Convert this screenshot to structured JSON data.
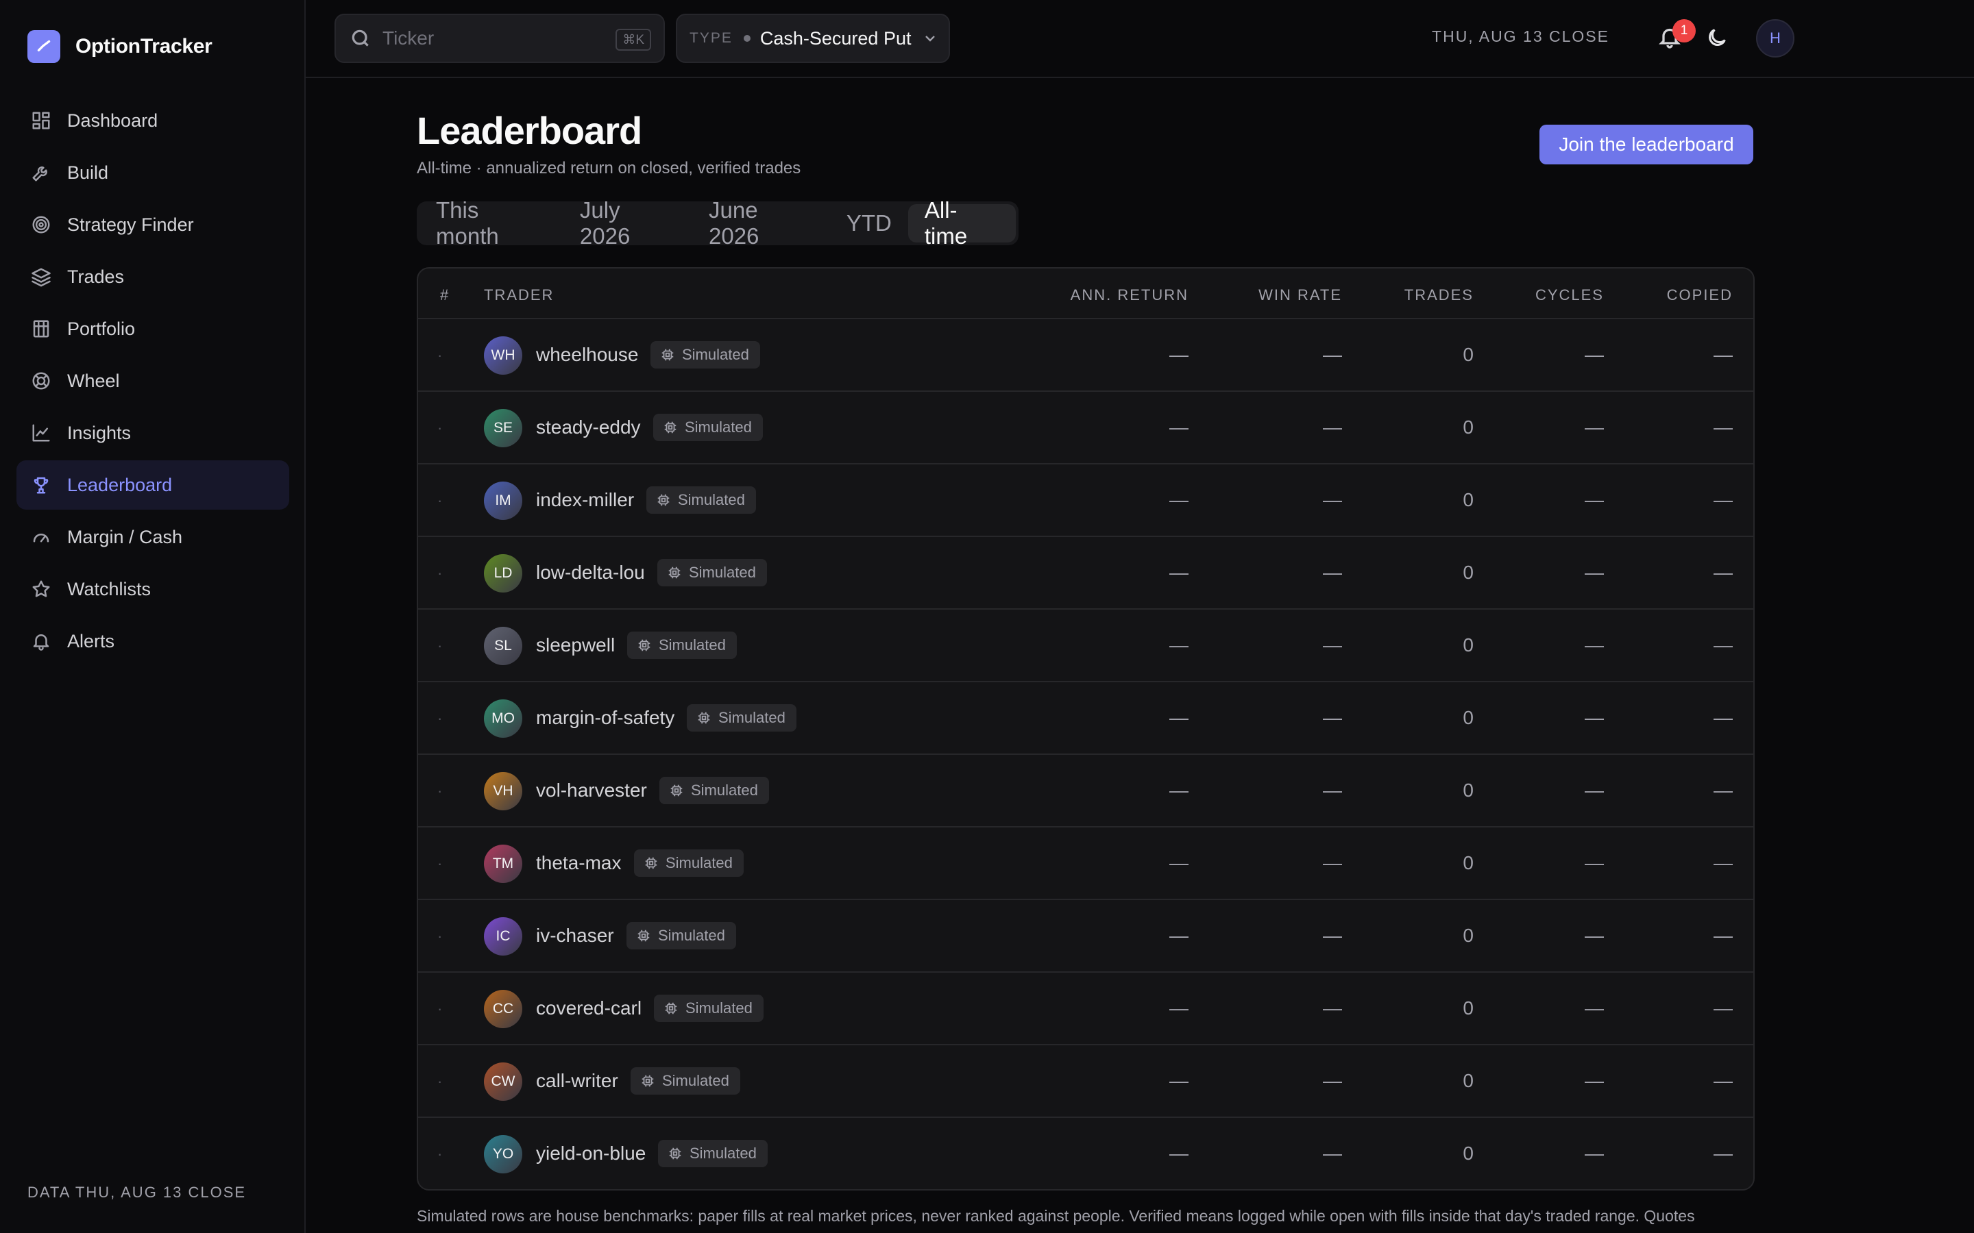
{
  "brand": {
    "name": "OptionTracker"
  },
  "nav": [
    {
      "label": "Dashboard",
      "icon": "dashboard-icon",
      "active": false
    },
    {
      "label": "Build",
      "icon": "wrench-icon",
      "active": false
    },
    {
      "label": "Strategy Finder",
      "icon": "target-icon",
      "active": false
    },
    {
      "label": "Trades",
      "icon": "layers-icon",
      "active": false
    },
    {
      "label": "Portfolio",
      "icon": "building-icon",
      "active": false
    },
    {
      "label": "Wheel",
      "icon": "lifebuoy-icon",
      "active": false
    },
    {
      "label": "Insights",
      "icon": "chart-line-icon",
      "active": false
    },
    {
      "label": "Leaderboard",
      "icon": "trophy-icon",
      "active": true
    },
    {
      "label": "Margin / Cash",
      "icon": "gauge-icon",
      "active": false
    },
    {
      "label": "Watchlists",
      "icon": "star-icon",
      "active": false
    },
    {
      "label": "Alerts",
      "icon": "bell-icon",
      "active": false
    }
  ],
  "sidebar_footer": "DATA THU, AUG 13 CLOSE",
  "topbar": {
    "search_placeholder": "Ticker",
    "search_value": "",
    "search_shortcut": "⌘K",
    "type_label": "TYPE",
    "type_value": "Cash-Secured Put",
    "close_label": "THU, AUG 13 CLOSE",
    "notification_count": "1",
    "avatar_initial": "H"
  },
  "page": {
    "title": "Leaderboard",
    "subtitle": "All-time · annualized return on closed, verified trades",
    "join_button": "Join the leaderboard"
  },
  "tabs": [
    {
      "label": "This month",
      "active": false
    },
    {
      "label": "July 2026",
      "active": false
    },
    {
      "label": "June 2026",
      "active": false
    },
    {
      "label": "YTD",
      "active": false
    },
    {
      "label": "All-time",
      "active": true
    }
  ],
  "table": {
    "headers": {
      "rank": "#",
      "trader": "TRADER",
      "ann_return": "ANN. RETURN",
      "win_rate": "WIN RATE",
      "trades": "TRADES",
      "cycles": "CYCLES",
      "copied": "COPIED"
    },
    "sim_label": "Simulated",
    "rows": [
      {
        "rank": "·",
        "initials": "WH",
        "name": "wheelhouse",
        "ann_return": "—",
        "win_rate": "—",
        "trades": "0",
        "cycles": "—",
        "copied": "—",
        "color": "#5b5fc7"
      },
      {
        "rank": "·",
        "initials": "SE",
        "name": "steady-eddy",
        "ann_return": "—",
        "win_rate": "—",
        "trades": "0",
        "cycles": "—",
        "copied": "—",
        "color": "#2e8b67"
      },
      {
        "rank": "·",
        "initials": "IM",
        "name": "index-miller",
        "ann_return": "—",
        "win_rate": "—",
        "trades": "0",
        "cycles": "—",
        "copied": "—",
        "color": "#4a5fb5"
      },
      {
        "rank": "·",
        "initials": "LD",
        "name": "low-delta-lou",
        "ann_return": "—",
        "win_rate": "—",
        "trades": "0",
        "cycles": "—",
        "copied": "—",
        "color": "#5f8a22"
      },
      {
        "rank": "·",
        "initials": "SL",
        "name": "sleepwell",
        "ann_return": "—",
        "win_rate": "—",
        "trades": "0",
        "cycles": "—",
        "copied": "—",
        "color": "#5f6270"
      },
      {
        "rank": "·",
        "initials": "MO",
        "name": "margin-of-safety",
        "ann_return": "—",
        "win_rate": "—",
        "trades": "0",
        "cycles": "—",
        "copied": "—",
        "color": "#2f8a6c"
      },
      {
        "rank": "·",
        "initials": "VH",
        "name": "vol-harvester",
        "ann_return": "—",
        "win_rate": "—",
        "trades": "0",
        "cycles": "—",
        "copied": "—",
        "color": "#c27a1c"
      },
      {
        "rank": "·",
        "initials": "TM",
        "name": "theta-max",
        "ann_return": "—",
        "win_rate": "—",
        "trades": "0",
        "cycles": "—",
        "copied": "—",
        "color": "#b03a5e"
      },
      {
        "rank": "·",
        "initials": "IC",
        "name": "iv-chaser",
        "ann_return": "—",
        "win_rate": "—",
        "trades": "0",
        "cycles": "—",
        "copied": "—",
        "color": "#7b4bd1"
      },
      {
        "rank": "·",
        "initials": "CC",
        "name": "covered-carl",
        "ann_return": "—",
        "win_rate": "—",
        "trades": "0",
        "cycles": "—",
        "copied": "—",
        "color": "#b5651d"
      },
      {
        "rank": "·",
        "initials": "CW",
        "name": "call-writer",
        "ann_return": "—",
        "win_rate": "—",
        "trades": "0",
        "cycles": "—",
        "copied": "—",
        "color": "#a9502a"
      },
      {
        "rank": "·",
        "initials": "YO",
        "name": "yield-on-blue",
        "ann_return": "—",
        "win_rate": "—",
        "trades": "0",
        "cycles": "—",
        "copied": "—",
        "color": "#2b7f8e"
      }
    ]
  },
  "footnote": "Simulated rows are house benchmarks: paper fills at real market prices, never ranked against people. Verified means logged while open with fills inside that day's traded range. Quotes",
  "colors": {
    "accent": "#6f76ea",
    "active_nav": "#8b93ff",
    "badge": "#ef4444"
  }
}
